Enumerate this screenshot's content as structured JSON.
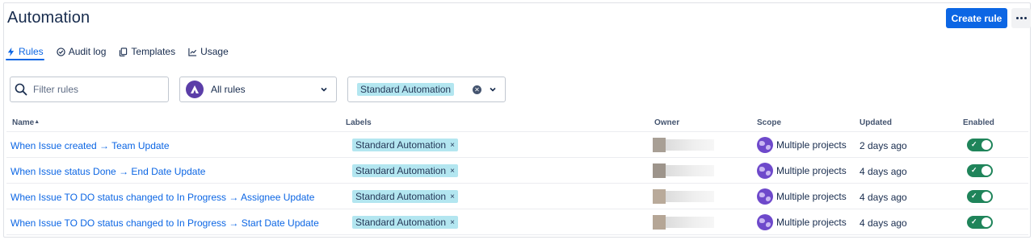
{
  "header": {
    "title": "Automation",
    "create_label": "Create rule"
  },
  "tabs": [
    {
      "label": "Rules",
      "active": true,
      "icon": "bolt-icon"
    },
    {
      "label": "Audit log",
      "active": false,
      "icon": "check-circle-icon"
    },
    {
      "label": "Templates",
      "active": false,
      "icon": "copy-icon"
    },
    {
      "label": "Usage",
      "active": false,
      "icon": "chart-icon"
    }
  ],
  "filters": {
    "search_placeholder": "Filter rules",
    "rules_select": "All rules",
    "label_chip": "Standard Automation"
  },
  "table": {
    "columns": [
      "Name",
      "Labels",
      "Owner",
      "Scope",
      "Updated",
      "Enabled"
    ],
    "rows": [
      {
        "name": "When Issue created → Team Update",
        "label": "Standard Automation",
        "scope": "Multiple projects",
        "updated": "2 days ago",
        "enabled": true
      },
      {
        "name": "When Issue status Done → End Date Update",
        "label": "Standard Automation",
        "scope": "Multiple projects",
        "updated": "4 days ago",
        "enabled": true
      },
      {
        "name": "When Issue TO DO status changed to In Progress → Assignee Update",
        "label": "Standard Automation",
        "scope": "Multiple projects",
        "updated": "4 days ago",
        "enabled": true
      },
      {
        "name": "When Issue TO DO status changed to In Progress → Start Date Update",
        "label": "Standard Automation",
        "scope": "Multiple projects",
        "updated": "4 days ago",
        "enabled": true
      }
    ]
  },
  "colors": {
    "primary": "#0c66e4",
    "label_bg": "#b3e6f0",
    "toggle_on": "#1f845a",
    "scope_icon": "#6e49cb"
  }
}
